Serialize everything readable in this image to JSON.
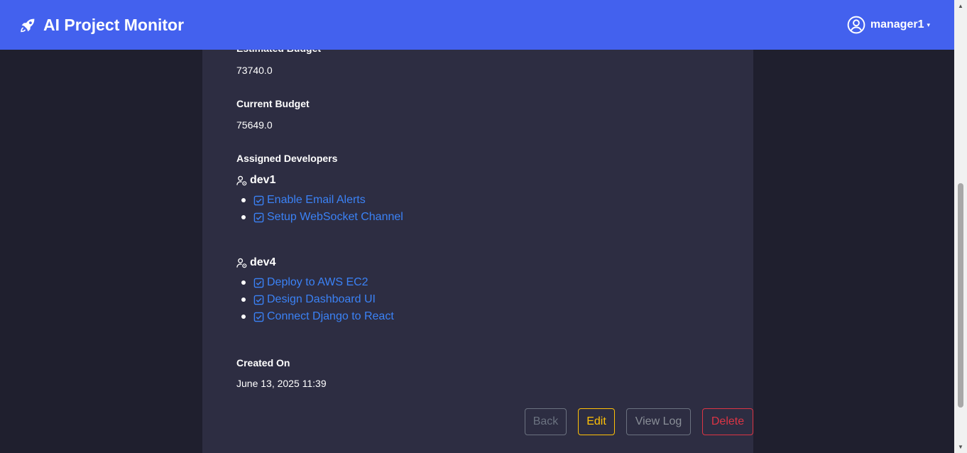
{
  "brand": {
    "title": "AI Project Monitor",
    "icon": "rocket-icon"
  },
  "user": {
    "name": "manager1",
    "icon": "user-circle-icon",
    "caret": "▾"
  },
  "fields": {
    "estimated_budget": {
      "label": "Estimated Budget",
      "value": "73740.0"
    },
    "current_budget": {
      "label": "Current Budget",
      "value": "75649.0"
    },
    "assigned_label": "Assigned Developers",
    "created_on": {
      "label": "Created On",
      "value": "June 13, 2025 11:39"
    }
  },
  "developers": [
    {
      "name": "dev1",
      "tasks": [
        "Enable Email Alerts",
        "Setup WebSocket Channel"
      ]
    },
    {
      "name": "dev4",
      "tasks": [
        "Deploy to AWS EC2",
        "Design Dashboard UI",
        "Connect Django to React"
      ]
    }
  ],
  "actions": {
    "back": "Back",
    "edit": "Edit",
    "view_log": "View Log",
    "delete": "Delete"
  },
  "colors": {
    "navbar": "#4361ee",
    "background": "#1f1f2e",
    "card": "#2d2d42",
    "link": "#3b82f6",
    "edit": "#ffc107",
    "delete": "#dc3545",
    "muted": "#6b7280"
  }
}
